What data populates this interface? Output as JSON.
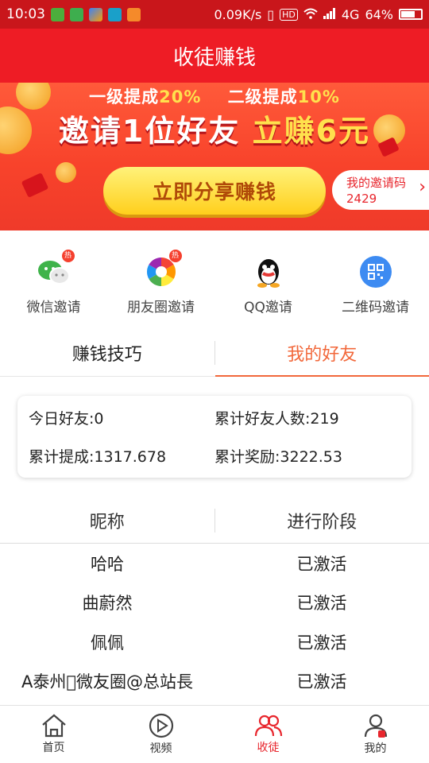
{
  "status_bar": {
    "time": "10:03",
    "speed": "0.09K/s",
    "network": "4G",
    "battery": "64%"
  },
  "header": {
    "title": "收徒赚钱"
  },
  "banner": {
    "line1_a": "一级提成",
    "line1_a_pct": "20%",
    "line1_b": "二级提成",
    "line1_b_pct": "10%",
    "line2_a": "邀请1位好友",
    "line2_b": "立赚6元",
    "share_button": "立即分享赚钱",
    "invite_code_label": "我的邀请码",
    "invite_code": "2429"
  },
  "share_options": [
    {
      "label": "微信邀请",
      "icon": "wechat-icon"
    },
    {
      "label": "朋友圈邀请",
      "icon": "moments-icon"
    },
    {
      "label": "QQ邀请",
      "icon": "qq-icon"
    },
    {
      "label": "二维码邀请",
      "icon": "qrcode-icon"
    }
  ],
  "tabs": [
    {
      "label": "赚钱技巧",
      "active": false
    },
    {
      "label": "我的好友",
      "active": true
    }
  ],
  "stats": {
    "today_friends": "今日好友:0",
    "total_friends": "累计好友人数:219",
    "total_commission": "累计提成:1317.678",
    "total_reward": "累计奖励:3222.53"
  },
  "friends_table": {
    "columns": [
      "昵称",
      "进行阶段"
    ],
    "rows": [
      [
        "哈哈",
        "已激活"
      ],
      [
        "曲蔚然",
        "已激活"
      ],
      [
        "佩佩",
        "已激活"
      ],
      [
        "A泰州\u0000微友圈@总站長",
        "已激活"
      ]
    ]
  },
  "bottom_nav": [
    {
      "label": "首页",
      "icon": "home-icon"
    },
    {
      "label": "视频",
      "icon": "play-icon"
    },
    {
      "label": "收徒",
      "icon": "users-icon",
      "active": true
    },
    {
      "label": "我的",
      "icon": "profile-icon"
    }
  ],
  "colors": {
    "primary_red": "#ee1c25",
    "status_red": "#c9161b",
    "accent_orange": "#f2683b",
    "yellow": "#ffe14d"
  }
}
